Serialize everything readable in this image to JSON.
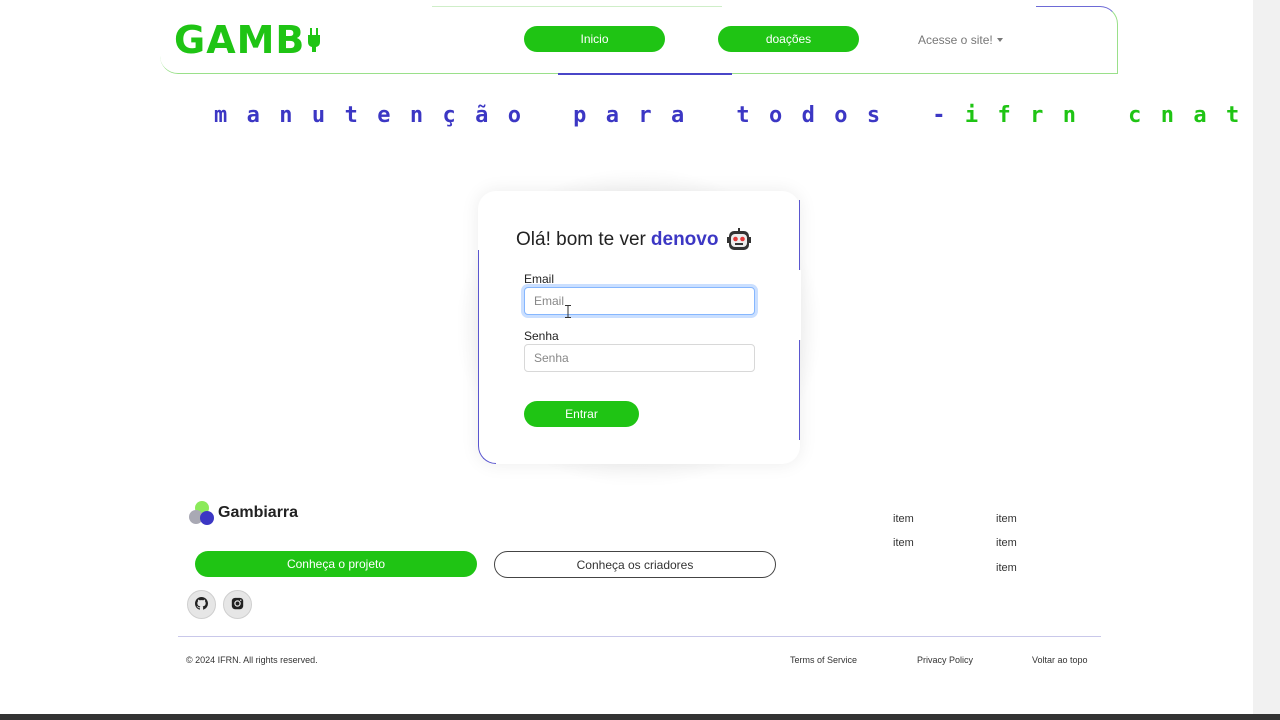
{
  "header": {
    "logo_text_green": "GAMB",
    "logo_text_gray": "",
    "nav": {
      "inicio": "Inicio",
      "doacoes": "doações",
      "dropdown": "Acesse o site!"
    }
  },
  "banner": {
    "text_main": "manutenção para todos -",
    "text_green": "ifrn cnat"
  },
  "login": {
    "title_prefix": "Olá! bom te ver",
    "title_accent": "denovo",
    "email_label": "Email",
    "email_placeholder": "Email",
    "senha_label": "Senha",
    "senha_placeholder": "Senha",
    "submit": "Entrar"
  },
  "footer": {
    "brand": "Gambiarra",
    "btn_projeto": "Conheça o projeto",
    "btn_criadores": "Conheça os criadores",
    "links_col1": [
      "item",
      "item"
    ],
    "links_col2": [
      "item",
      "item",
      "item"
    ],
    "copyright": "© 2024 IFRN. All rights reserved.",
    "bottom_links": {
      "terms": "Terms of Service",
      "privacy": "Privacy Policy",
      "top": "Voltar ao topo"
    }
  },
  "icons": {
    "plug": "plug-icon",
    "robot": "robot-icon",
    "github": "github-icon",
    "instagram": "instagram-icon",
    "caret": "chevron-down-icon",
    "cursor": "text-cursor-icon"
  },
  "colors": {
    "green": "#1fc414",
    "indigo": "#3c37c4"
  }
}
